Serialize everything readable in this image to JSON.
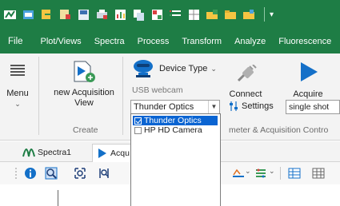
{
  "quick_access": {
    "icons": [
      "app-logo-icon",
      "qat-icon-1",
      "qat-icon-2",
      "qat-icon-3",
      "qat-icon-4",
      "qat-icon-5",
      "qat-icon-6",
      "qat-icon-7",
      "qat-icon-8",
      "qat-icon-9",
      "qat-icon-10",
      "qat-icon-11",
      "qat-icon-12"
    ],
    "dropdown_glyph": "▾"
  },
  "menu_tabs": [
    "File",
    "Plot/Views",
    "Spectra",
    "Process",
    "Transform",
    "Analyze",
    "Fluorescence"
  ],
  "ribbon": {
    "menu_label": "Menu",
    "menu_chevron": "⌄",
    "new_acquisition_label": "new Acquisition View",
    "create_group_label": "Create",
    "device_type_label": "Device Type",
    "device_type_chevron": "⌄",
    "device_subtitle": "USB webcam",
    "device_selected": "Thunder Optics",
    "connect_label": "Connect",
    "acquire_label": "Acquire",
    "settings_label": "Settings",
    "shot_mode": "single shot",
    "params_group_label": "meter & Acquisition Contro"
  },
  "device_dropdown": {
    "options": [
      {
        "label": "Thunder Optics",
        "selected": true,
        "checked": true
      },
      {
        "label": "HP HD Camera",
        "selected": false,
        "checked": false
      }
    ]
  },
  "doc_tabs": {
    "spectra_label": "Spectra1",
    "acq_label": "Acqu"
  },
  "colors": {
    "ribbon_green": "#1e7d45",
    "selection_blue": "#0a64d2",
    "acquire_blue": "#1470c8"
  }
}
